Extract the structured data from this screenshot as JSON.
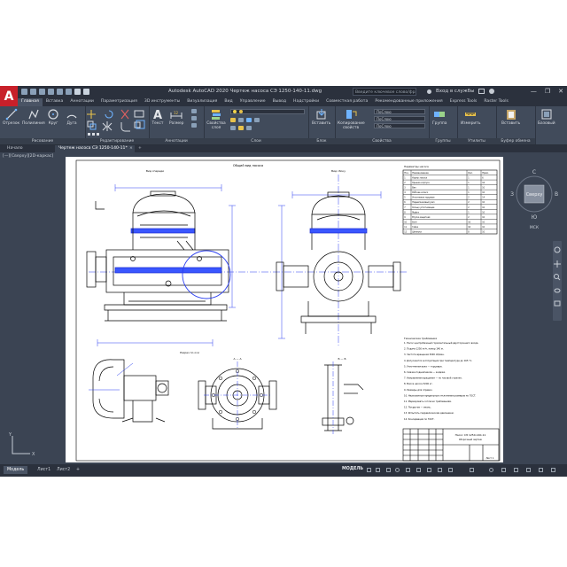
{
  "app": {
    "logo": "A",
    "title": "Autodesk AutoCAD 2020   Чертеж насоса СЭ 1250-140-11.dwg",
    "search_placeholder": "Введите ключевое слово/фразу",
    "user_label": "Вход в службы",
    "window_controls": [
      "—",
      "❐",
      "✕"
    ]
  },
  "ribbon": {
    "tabs": [
      "Главная",
      "Вставка",
      "Аннотации",
      "Параметризация",
      "3D инструменты",
      "Визуализация",
      "Вид",
      "Управление",
      "Вывод",
      "Надстройки",
      "Совместная работа",
      "Рекомендованные приложения",
      "Express Tools",
      "Raster Tools"
    ],
    "active_tab": "Главная",
    "panels": {
      "draw": {
        "label": "Рисование",
        "tools": [
          "Отрезок",
          "Полилиния",
          "Круг",
          "Дуга"
        ]
      },
      "modify": {
        "label": "Редактирование"
      },
      "annotation": {
        "label": "Аннотации",
        "tools": [
          "Текст",
          "Размер"
        ]
      },
      "layers": {
        "label": "Слои",
        "tools": [
          "Свойства слоя"
        ]
      },
      "block": {
        "label": "Блок",
        "tools": [
          "Вставить"
        ]
      },
      "properties": {
        "label": "Свойства",
        "tools": [
          "Копирование свойств"
        ],
        "combos": [
          "ПоСлою",
          "ПоСлою",
          "ПоСлою"
        ]
      },
      "groups": {
        "label": "Группы",
        "tools": [
          "Группа"
        ]
      },
      "utilities": {
        "label": "Утилиты",
        "tools": [
          "Измерить"
        ]
      },
      "clipboard": {
        "label": "Буфер обмена",
        "tools": [
          "Вставить"
        ]
      },
      "view": {
        "tools": [
          "Базовый"
        ]
      }
    }
  },
  "doc_tabs": [
    "Начало",
    "Чертеж насоса СЭ 1250-140-11*"
  ],
  "viewport": {
    "label": "[—][Сверху][2D-каркас]",
    "viewcube": {
      "face": "Сверху",
      "n": "С",
      "s": "Ю",
      "w": "З",
      "e": "В",
      "wcs": "МСК"
    },
    "accent_color": "#2b3ff0",
    "line_color": "#000000"
  },
  "drawing": {
    "sheet_title": "Общий вид насоса",
    "view_labels": [
      "Вид спереди",
      "Вид сбоку",
      "Разрез по оси",
      "А — А",
      "Б — Б"
    ],
    "table_title": "Параметры насоса",
    "table_header": [
      "Поз.",
      "Наименование",
      "Кол.",
      "Прим."
    ],
    "table_rows": [
      [
        "1",
        "Корпус насоса",
        "1",
        "6"
      ],
      [
        "2",
        "Крышка корпуса",
        "1",
        "16"
      ],
      [
        "3",
        "Вал",
        "1",
        "10"
      ],
      [
        "4",
        "Рабочее колесо",
        "1",
        "10"
      ],
      [
        "5",
        "Уплотнение торцевое",
        "2",
        "14"
      ],
      [
        "6",
        "Подшипниковый узел",
        "2",
        "10"
      ],
      [
        "7",
        "Кольцо уплотняющее",
        "2",
        "10"
      ],
      [
        "8",
        "Муфта",
        "1",
        "10"
      ],
      [
        "9",
        "Втулка защитная",
        "2",
        "10"
      ],
      [
        "10",
        "Болт",
        "16",
        "10"
      ],
      [
        "11",
        "Гайка",
        "16",
        "10"
      ],
      [
        "12",
        "Шпилька",
        "8",
        "10"
      ]
    ],
    "notes_title": "Технические требования",
    "notes": [
      "1. Насос центробежный горизонтальный двустороннего входа.",
      "2. Подача 1250 м³/ч, напор 140 м.",
      "3. Частота вращения 3000 об/мин.",
      "4. Допускается эксплуатация при температуре до 165 °С.",
      "5. Уплотнения вала — торцевые.",
      "6. Смазка подшипников — жидкая.",
      "7. Направление вращения — по часовой стрелке.",
      "8. Масса насоса 5200 кг.",
      "9. Размеры для справок.",
      "10. Неуказанные предельные отклонения размеров по ГОСТ.",
      "11. Маркировать согласно требованиям.",
      "12. Покрытие — эмаль.",
      "13. Испытать гидравлическим давлением.",
      "14. Консервация по ГОСТ."
    ],
    "title_block": {
      "doc_title": "Насос СЭ 1250-140-11",
      "subtitle": "Сборочный чертеж",
      "sheet": "Лист 1"
    }
  },
  "bottom": {
    "layout_tabs": [
      "Модель",
      "Лист1",
      "Лист2"
    ],
    "add_tab": "+",
    "model_status": "МОДЕЛЬ"
  }
}
